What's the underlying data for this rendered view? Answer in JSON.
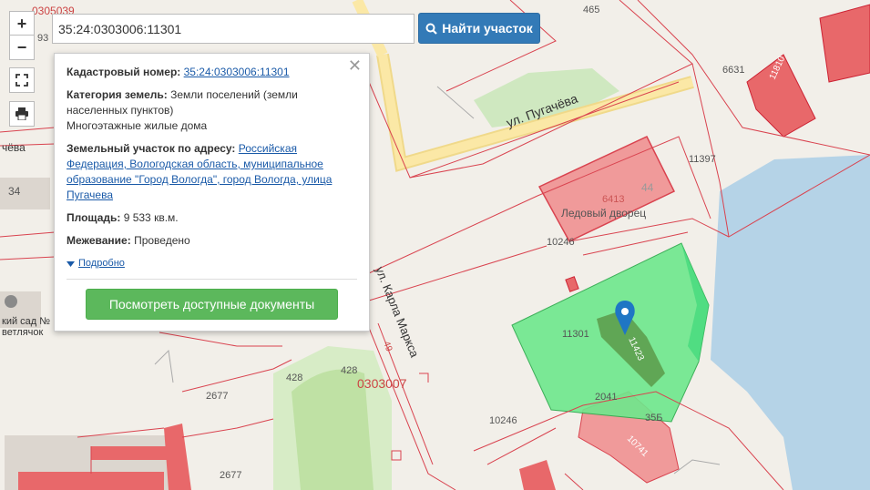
{
  "search": {
    "value": "35:24:0303006:11301",
    "button_label": "Найти участок"
  },
  "controls": {
    "zoom_in": "+",
    "zoom_out": "−"
  },
  "popup": {
    "cadastral_label": "Кадастровый номер:",
    "cadastral_value": "35:24:0303006:11301",
    "category_label": "Категория земель:",
    "category_value": "Земли поселений (земли населенных пунктов)",
    "usage": "Многоэтажные жилые дома",
    "address_label": "Земельный участок по адресу:",
    "address_value": "Российская Федерация, Вологодская область, муниципальное образование \"Город Вологда\", город Вологда, улица Пугачева",
    "area_label": "Площадь:",
    "area_value": "9 533 кв.м.",
    "survey_label": "Межевание:",
    "survey_value": "Проведено",
    "more_link": "Подробно",
    "docs_button": "Посмотреть доступные документы"
  },
  "map_labels": {
    "street_pugacheva": "ул. Пугачёва",
    "street_karla_marksa": "ул. Карла Маркса",
    "ice_palace": "Ледовый дворец",
    "block": "0303007",
    "garden_1": "кий сад №",
    "garden_2": "ветлячок",
    "parcel_selected": "11301",
    "n465": "465",
    "n6631": "6631",
    "n11810": "11810",
    "n11397": "11397",
    "n6413": "6413",
    "n44": "44",
    "n10246a": "10246",
    "n10246b": "10246",
    "n2041": "2041",
    "n35b": "35Б",
    "n10741": "10741",
    "n428a": "428",
    "n428b": "428",
    "n2677a": "2677",
    "n2677b": "2677",
    "n34": "34",
    "n49": "49",
    "n11423": "11423",
    "n0305": "0305039",
    "n93": "93",
    "n0304": "чёва"
  },
  "colors": {
    "selected_parcel": "#6ee88c",
    "building": "#e8686a",
    "water": "#b5d3e7",
    "boundary": "#d9434f",
    "road": "#fbe8a6",
    "green": "#cfe8c0",
    "accent": "#337ab7",
    "docs": "#5cb85c"
  }
}
